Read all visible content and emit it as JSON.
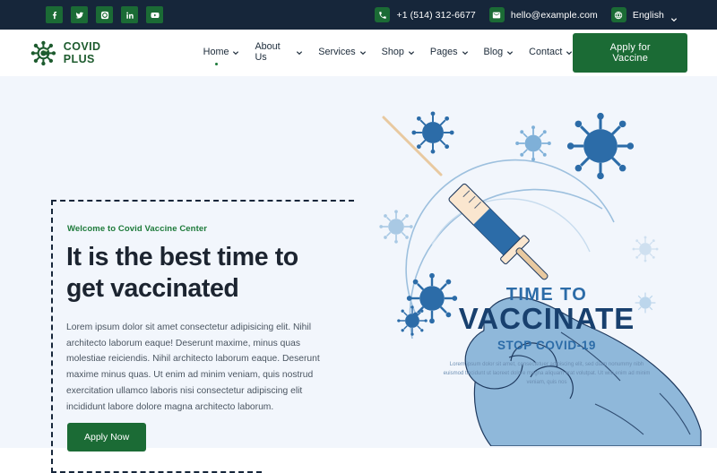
{
  "topbar": {
    "social": [
      {
        "name": "facebook",
        "label": "Facebook"
      },
      {
        "name": "twitter",
        "label": "Twitter"
      },
      {
        "name": "instagram",
        "label": "Instagram"
      },
      {
        "name": "linkedin",
        "label": "LinkedIn"
      },
      {
        "name": "youtube",
        "label": "YouTube"
      }
    ],
    "phone": "+1 (514) 312-6677",
    "email": "hello@example.com",
    "language": "English",
    "bg_color": "#16263a",
    "badge_color": "#1b6b35"
  },
  "header": {
    "logo_text": "COVID PLUS",
    "nav": [
      {
        "label": "Home",
        "active": true
      },
      {
        "label": "About Us",
        "active": false
      },
      {
        "label": "Services",
        "active": false
      },
      {
        "label": "Shop",
        "active": false
      },
      {
        "label": "Pages",
        "active": false
      },
      {
        "label": "Blog",
        "active": false
      },
      {
        "label": "Contact",
        "active": false
      }
    ],
    "cta_label": "Apply for Vaccine"
  },
  "hero": {
    "eyebrow": "Welcome to Covid Vaccine Center",
    "heading": "It is the best time to get vaccinated",
    "paragraph": "Lorem ipsum dolor sit amet consectetur adipisicing elit. Nihil architecto laborum eaque! Deserunt maxime, minus quas molestiae reiciendis. Nihil architecto laborum eaque. Deserunt maxime minus quas. Ut enim ad minim veniam, quis nostrud exercitation ullamco laboris nisi consectetur adipiscing elit incididunt labore dolore magna architecto laborum.",
    "button_label": "Apply Now",
    "bg_color": "#f2f6fc",
    "accent_color": "#1b6b35"
  },
  "illustration": {
    "title_small": "TIME TO",
    "title_big": "VACCINATE",
    "subtitle": "STOP COVID-19",
    "caption": "Lorem ipsum dolor sit amet, consectetuer adipiscing elit, sed diam nonummy nibh euismod tincidunt ut laoreet dolore magna aliquam erat volutpat. Ut wisi enim ad minim veniam, quis nos",
    "primary_blue": "#2c6ca8",
    "light_blue": "#8fb8da"
  }
}
